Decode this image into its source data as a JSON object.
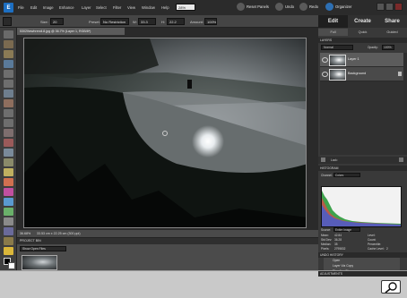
{
  "menubar": {
    "logo": "E",
    "items": [
      "File",
      "Edit",
      "Image",
      "Enhance",
      "Layer",
      "Select",
      "Filter",
      "View",
      "Window",
      "Help"
    ],
    "zoom_value": "28%",
    "buttons": [
      {
        "label": "Reset Panels"
      },
      {
        "label": "Undo"
      },
      {
        "label": "Redo"
      },
      {
        "label": "Organizer"
      }
    ]
  },
  "options": {
    "size_label": "Size:",
    "size_value": "20 px",
    "preset_label": "Preset:",
    "preset_value": "No Restriction",
    "width_label": "W:",
    "width_value": "33.3 cm",
    "height_label": "H:",
    "height_value": "22.2 cm",
    "amount_label": "Amount:",
    "amount_value": "100%"
  },
  "document": {
    "tab_title": "5302lhewhrercli.8.jpg @ 36.7% (Layer 1, RGB/8*)",
    "zoom": "36.68%",
    "status": "33.53 cm x 22.25 cm (300 ppi)"
  },
  "project_bin": {
    "header": "PROJECT BIN",
    "show_label": "Show Open Files"
  },
  "right_panel": {
    "modes": [
      {
        "label": "Edit"
      },
      {
        "label": "Create"
      },
      {
        "label": "Share"
      }
    ],
    "subtabs": [
      {
        "label": "Full"
      },
      {
        "label": "Quick"
      },
      {
        "label": "Guided"
      }
    ],
    "layers": {
      "header": "LAYERS",
      "blend_mode": "Normal",
      "opacity_label": "Opacity:",
      "opacity_value": "100%",
      "lock_label": "Lock:",
      "rows": [
        {
          "name": "Layer 1",
          "selected": true
        },
        {
          "name": "Background",
          "selected": false
        }
      ]
    },
    "histogram": {
      "header": "HISTOGRAM",
      "channel_label": "Channel:",
      "channel_value": "Colors",
      "source_label": "Source:",
      "source_value": "Entire Image",
      "stats_left": [
        {
          "label": "Mean:",
          "value": "42.84"
        },
        {
          "label": "Std Dev:",
          "value": "36.28"
        },
        {
          "label": "Median:",
          "value": "35"
        },
        {
          "label": "Pixels:",
          "value": "2795832"
        }
      ],
      "stats_right": [
        {
          "label": "Level:"
        },
        {
          "label": "Count:"
        },
        {
          "label": "Percentile:"
        },
        {
          "label": "Cache Level:",
          "value": "2"
        }
      ]
    },
    "undo_history": {
      "header": "UNDO HISTORY",
      "items": [
        {
          "label": "Open"
        },
        {
          "label": "Layer Via Copy"
        },
        {
          "label": "Blending Change"
        },
        {
          "label": "Motion Blur/Change"
        },
        {
          "label": "Merge Down",
          "active": true
        }
      ]
    },
    "adjustments_header": "ADJUSTMENTS"
  },
  "colors": {
    "accent": "#1d6fc2",
    "panel_bg": "#393939",
    "workspace_bg": "#2a2a2a"
  },
  "icons": [
    "hand-icon",
    "zoom-icon",
    "move-icon",
    "eye-icon",
    "search-magnifier-icon"
  ]
}
